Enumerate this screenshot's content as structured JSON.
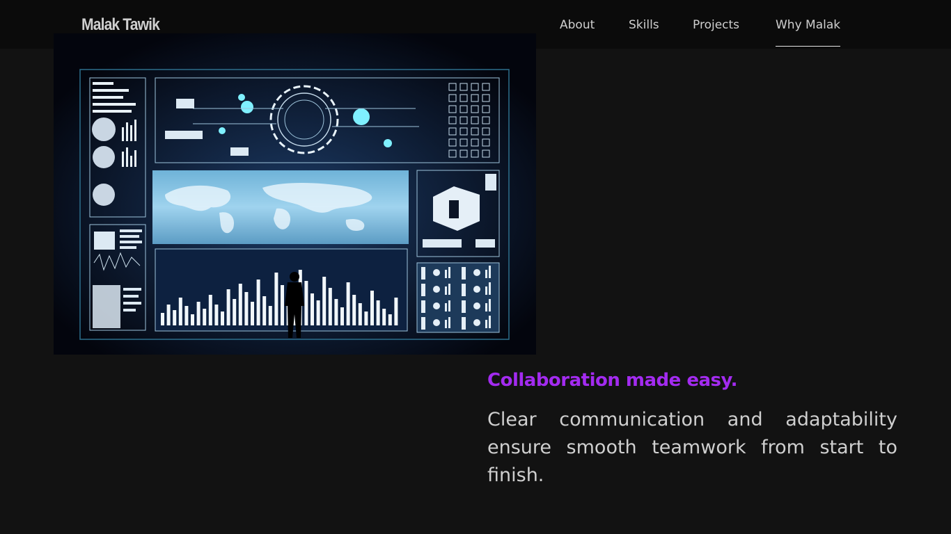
{
  "brand": "Malak Tawik",
  "nav": {
    "items": [
      "About",
      "Skills",
      "Projects",
      "Why Malak"
    ],
    "active": "Why Malak"
  },
  "hero": {
    "image": "futuristic data dashboard with world map and silhouette of a man"
  },
  "section": {
    "headline": "Collaboration made easy.",
    "body": "Clear communication and adaptability ensure smooth teamwork from start to finish."
  },
  "colors": {
    "background": "#121212",
    "topbar": "#0b0b0b",
    "accent": "#a32bf0",
    "text": "#cfcfcf"
  }
}
